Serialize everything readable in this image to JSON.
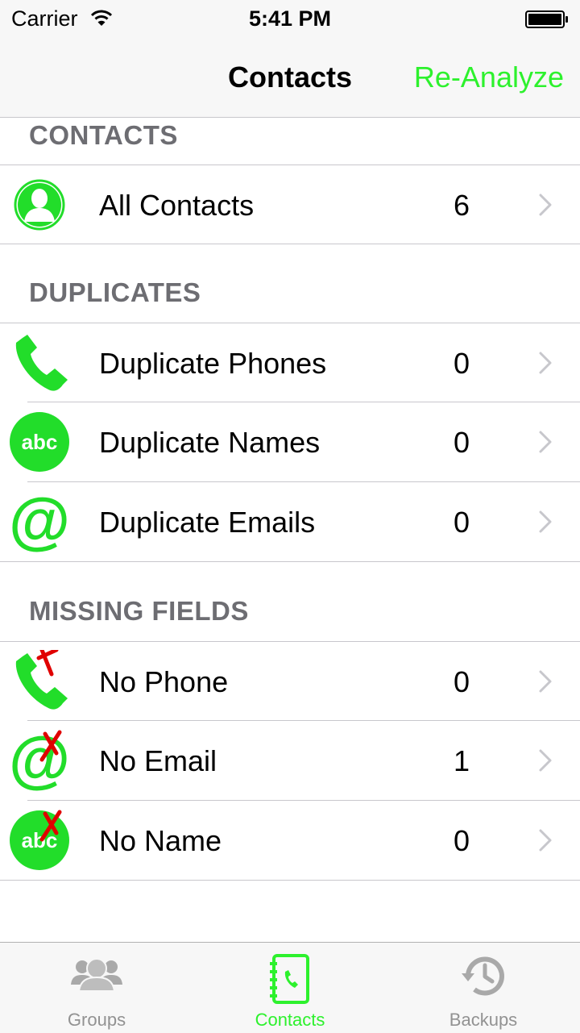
{
  "status_bar": {
    "carrier": "Carrier",
    "time": "5:41 PM"
  },
  "nav": {
    "title": "Contacts",
    "action": "Re-Analyze"
  },
  "colors": {
    "accent": "#2df12d",
    "icon_green": "#22dd2a",
    "red_x": "#e00000",
    "inactive": "#929292"
  },
  "sections": [
    {
      "header": "CONTACTS",
      "rows": [
        {
          "label": "All Contacts",
          "count": "6",
          "icon": "person-icon"
        }
      ]
    },
    {
      "header": "DUPLICATES",
      "rows": [
        {
          "label": "Duplicate Phones",
          "count": "0",
          "icon": "phone-icon"
        },
        {
          "label": "Duplicate Names",
          "count": "0",
          "icon": "abc-icon"
        },
        {
          "label": "Duplicate Emails",
          "count": "0",
          "icon": "at-icon"
        }
      ]
    },
    {
      "header": "MISSING FIELDS",
      "rows": [
        {
          "label": "No Phone",
          "count": "0",
          "icon": "phone-missing-icon"
        },
        {
          "label": "No Email",
          "count": "1",
          "icon": "at-missing-icon"
        },
        {
          "label": "No Name",
          "count": "0",
          "icon": "abc-missing-icon"
        }
      ]
    }
  ],
  "tabs": [
    {
      "label": "Groups",
      "icon": "groups-icon",
      "active": false
    },
    {
      "label": "Contacts",
      "icon": "contacts-book-icon",
      "active": true
    },
    {
      "label": "Backups",
      "icon": "history-icon",
      "active": false
    }
  ],
  "icon_text": {
    "abc": "abc",
    "at": "@"
  }
}
